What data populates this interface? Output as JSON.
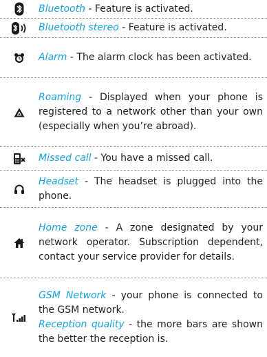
{
  "rows": [
    {
      "icon": "bluetooth-icon",
      "term": "Bluetooth",
      "text": " - Feature is activated."
    },
    {
      "icon": "bluetooth-stereo-icon",
      "term": "Bluetooth stereo",
      "text": " - Feature is activated."
    },
    {
      "icon": "alarm-clock-icon",
      "term": "Alarm",
      "text": " - The alarm clock has been activated."
    },
    {
      "icon": "roaming-icon",
      "term": "Roaming",
      "text": " - Displayed when your phone is registered to a network other than your own (especially when you’re abroad)."
    },
    {
      "icon": "missed-call-icon",
      "term": "Missed call",
      "text": " - You have a missed call."
    },
    {
      "icon": "headset-icon",
      "term": "Headset",
      "text": " - The headset is plugged into the phone."
    },
    {
      "icon": "home-zone-icon",
      "term": "Home zone",
      "text": " - A zone designated by your network operator. Subscription dependent, contact your service provider for details."
    },
    {
      "icon": "gsm-signal-icon",
      "term": "GSM Network",
      "text": " - your phone is connected to the GSM network.",
      "term2": "Reception quality",
      "text2": " - the more bars are shown the better the reception is."
    }
  ],
  "colors": {
    "term": "#1aa3d9",
    "body_text": "#231f20",
    "divider": "#9a9a9a",
    "icon": "#1a1a1a"
  }
}
